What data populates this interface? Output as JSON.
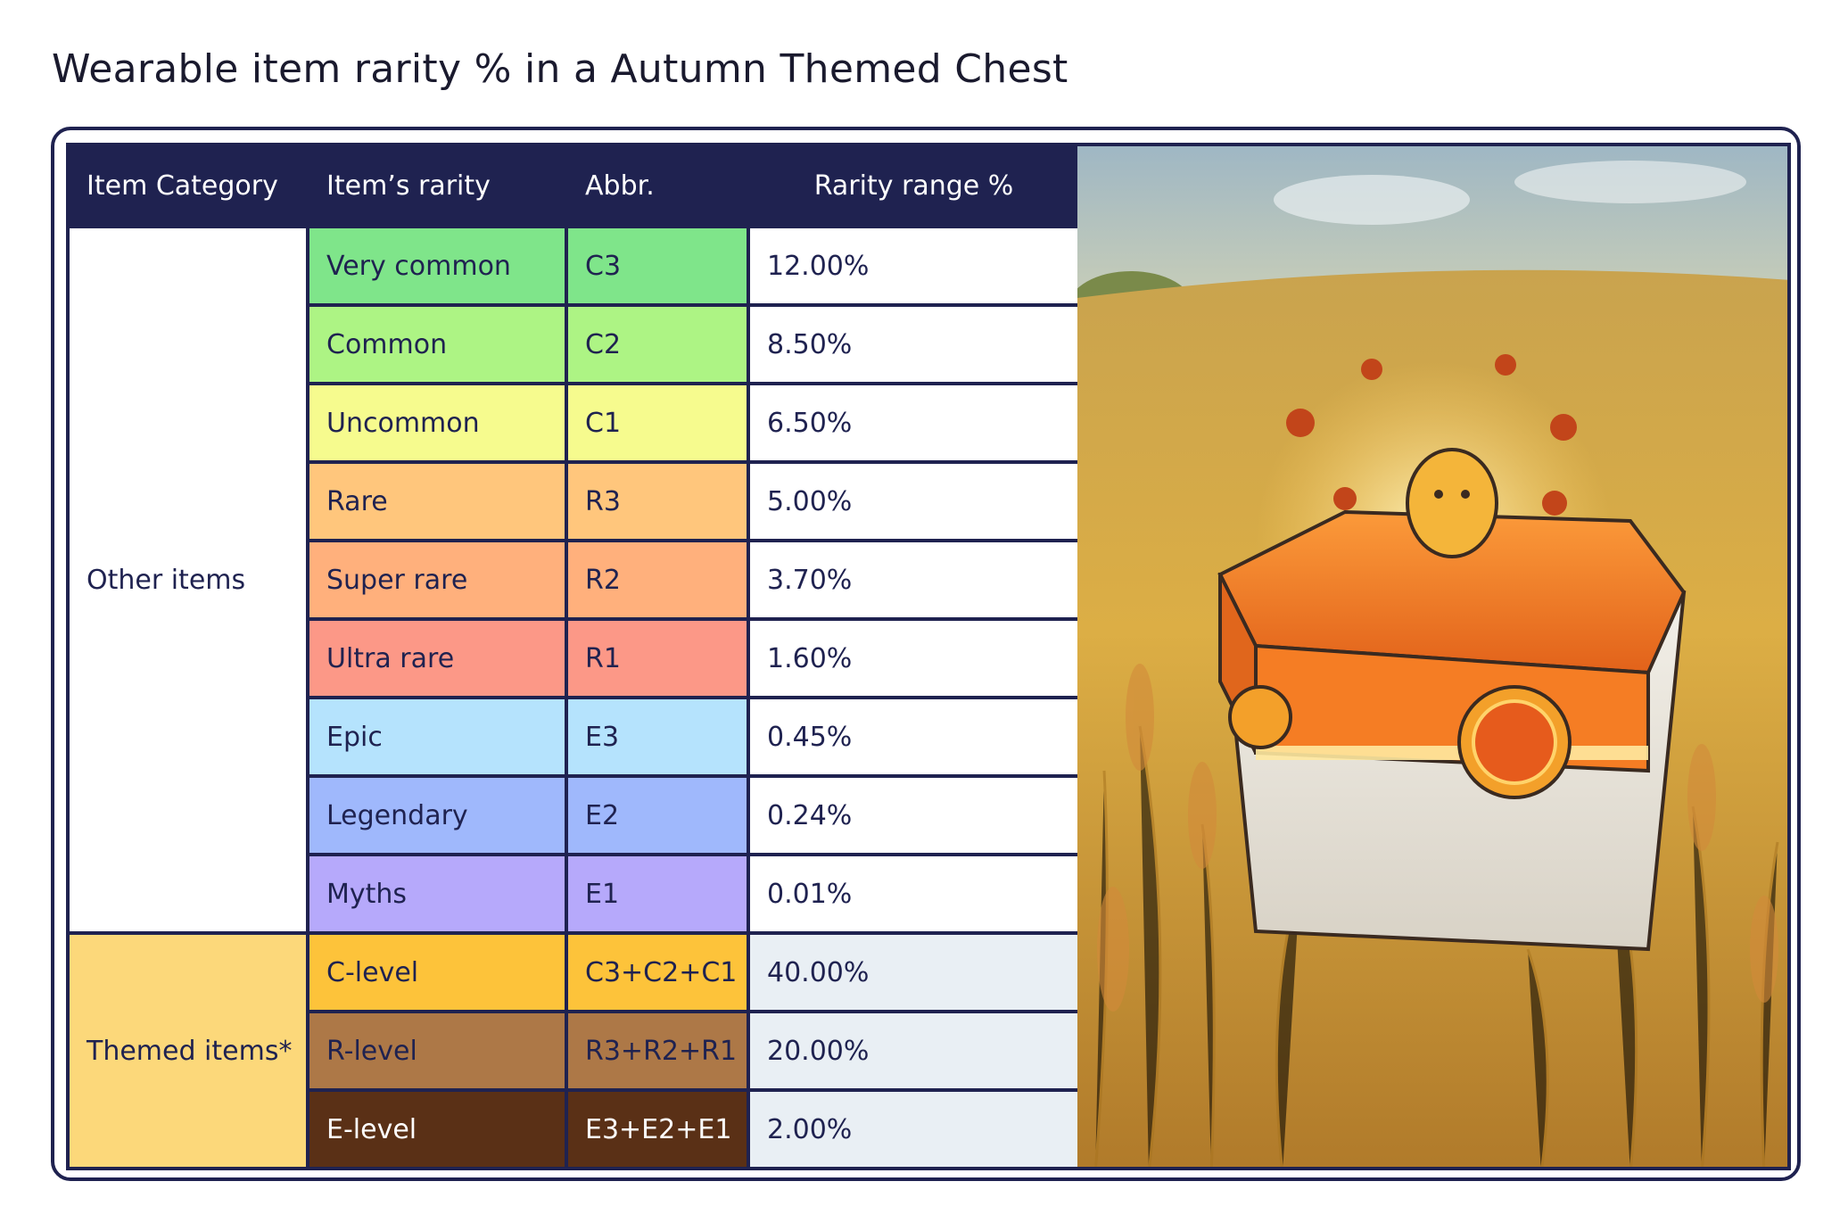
{
  "title": "Wearable item rarity % in a Autumn Themed Chest",
  "table": {
    "headers": [
      "Item Category",
      "Item’s rarity",
      "Abbr.",
      "Rarity range %"
    ],
    "groups": [
      {
        "category": "Other items",
        "rows": [
          {
            "rarity": "Very common",
            "abbr": "C3",
            "value": "12.00%",
            "color": "#7fe58a"
          },
          {
            "rarity": "Common",
            "abbr": "C2",
            "value": "8.50%",
            "color": "#adf484"
          },
          {
            "rarity": "Uncommon",
            "abbr": "C1",
            "value": "6.50%",
            "color": "#f6fb8e"
          },
          {
            "rarity": "Rare",
            "abbr": "R3",
            "value": "5.00%",
            "color": "#ffc67c"
          },
          {
            "rarity": "Super rare",
            "abbr": "R2",
            "value": "3.70%",
            "color": "#ffb07c"
          },
          {
            "rarity": "Ultra rare",
            "abbr": "R1",
            "value": "1.60%",
            "color": "#fc9887"
          },
          {
            "rarity": "Epic",
            "abbr": "E3",
            "value": "0.45%",
            "color": "#b5e3fd"
          },
          {
            "rarity": "Legendary",
            "abbr": "E2",
            "value": "0.24%",
            "color": "#9fb8fc"
          },
          {
            "rarity": "Myths",
            "abbr": "E1",
            "value": "0.01%",
            "color": "#b6a9fb"
          }
        ]
      },
      {
        "category": "Themed items*",
        "rows": [
          {
            "rarity": "C-level",
            "abbr": "C3+C2+C1",
            "value": "40.00%",
            "color": "#fdc33a"
          },
          {
            "rarity": "R-level",
            "abbr": "R3+R2+R1",
            "value": "20.00%",
            "color": "#ad7847"
          },
          {
            "rarity": "E-level",
            "abbr": "E3+E2+E1",
            "value": "2.00%",
            "color": "#5a3016"
          }
        ]
      }
    ]
  },
  "illustration": {
    "icon": "autumn-chest-illustration",
    "chest_color": "#f07a1e",
    "field_color": "#d9a83c"
  }
}
